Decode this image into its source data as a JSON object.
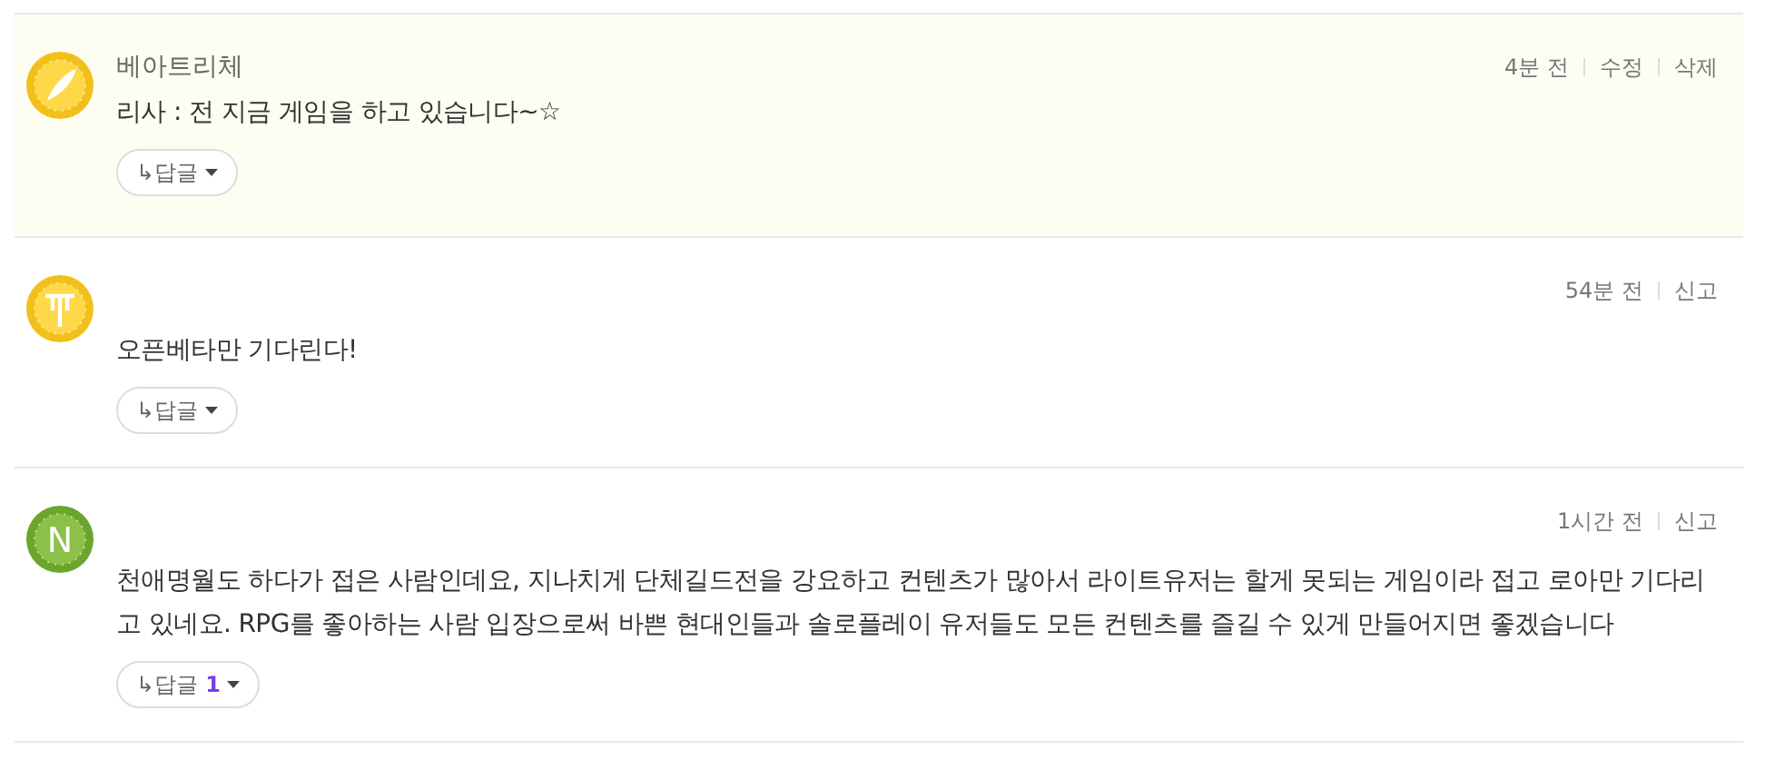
{
  "comments": [
    {
      "mine": true,
      "avatar": {
        "kind": "feather"
      },
      "author": "베아트리체",
      "time": "4분 전",
      "actions": [
        "수정",
        "삭제"
      ],
      "text": "리사 : 전 지금 게임을 하고 있습니다~☆",
      "reply": {
        "label": "↳답글"
      }
    },
    {
      "mine": false,
      "avatar": {
        "kind": "emblem"
      },
      "time": "54분 전",
      "actions": [
        "신고"
      ],
      "text": "오픈베타만 기다린다!",
      "reply": {
        "label": "↳답글"
      }
    },
    {
      "mine": false,
      "avatar": {
        "kind": "letter",
        "letter": "N"
      },
      "time": "1시간 전",
      "actions": [
        "신고"
      ],
      "text": "천애명월도 하다가 접은 사람인데요, 지나치게 단체길드전을 강요하고 컨텐츠가 많아서 라이트유저는 할게 못되는 게임이라 접고 로아만 기다리고 있네요. RPG를 좋아하는 사람 입장으로써 바쁜 현대인들과 솔로플레이 유저들도 모든 컨텐츠를 즐길 수 있게 만들어지면 좋겠습니다",
      "reply": {
        "label": "↳답글",
        "count": "1"
      }
    }
  ]
}
